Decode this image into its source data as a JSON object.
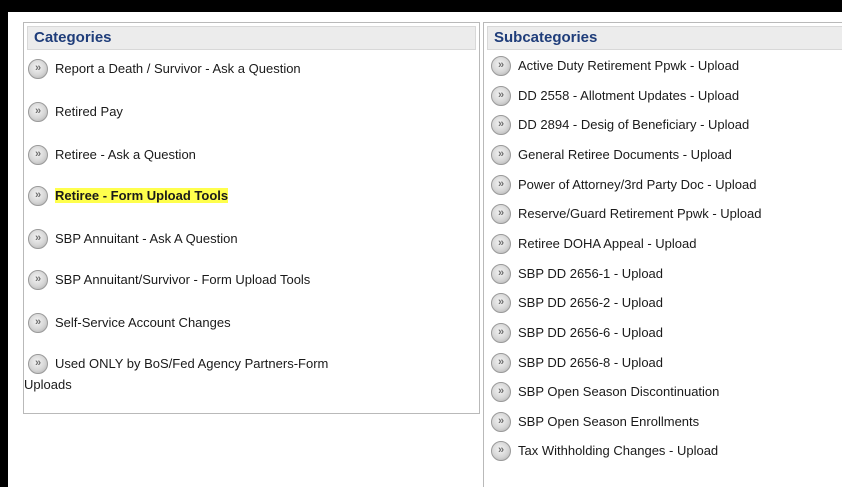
{
  "categories": {
    "header": "Categories",
    "items": [
      {
        "label": "Report a Death / Survivor - Ask a Question",
        "highlighted": false
      },
      {
        "label": "Retired Pay",
        "highlighted": false
      },
      {
        "label": "Retiree - Ask a Question",
        "highlighted": false
      },
      {
        "label": "Retiree - Form Upload Tools",
        "highlighted": true
      },
      {
        "label": "SBP Annuitant - Ask A Question",
        "highlighted": false
      },
      {
        "label": "SBP Annuitant/Survivor - Form Upload Tools",
        "highlighted": false
      },
      {
        "label": "Self-Service Account Changes",
        "highlighted": false
      },
      {
        "label": "Used ONLY by BoS/Fed Agency Partners-Form",
        "label_continued": "Uploads",
        "highlighted": false
      }
    ]
  },
  "subcategories": {
    "header": "Subcategories",
    "items": [
      "Active Duty Retirement Ppwk - Upload",
      "DD 2558 - Allotment Updates - Upload",
      "DD 2894 - Desig of Beneficiary - Upload",
      "General Retiree Documents - Upload",
      "Power of Attorney/3rd Party Doc - Upload",
      "Reserve/Guard Retirement Ppwk - Upload",
      "Retiree DOHA Appeal - Upload",
      "SBP DD 2656-1 - Upload",
      "SBP DD 2656-2 - Upload",
      "SBP DD 2656-6 - Upload",
      "SBP DD 2656-8 - Upload",
      "SBP Open Season Discontinuation",
      "SBP Open Season Enrollments",
      "Tax Withholding Changes - Upload"
    ]
  },
  "colors": {
    "header_text": "#1f3d7a",
    "highlight": "#ffff4d"
  },
  "icons": {
    "item_button": "double-chevron-right-icon"
  }
}
